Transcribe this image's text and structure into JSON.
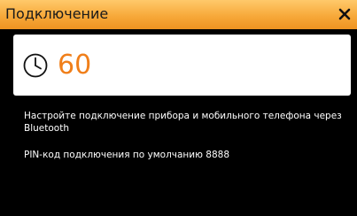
{
  "window": {
    "title": "Подключение",
    "close_icon": "close-icon"
  },
  "timer": {
    "icon": "clock-icon",
    "value": "60",
    "value_color": "#f07f1a"
  },
  "message": {
    "instruction": "Настройте подключение прибора и мобильного телефона через Bluetooth",
    "pin_info": "PIN-код подключения по умолчанию 8888"
  },
  "colors": {
    "titlebar_accent": "#f7a93a",
    "background": "#000000",
    "panel": "#ffffff"
  }
}
